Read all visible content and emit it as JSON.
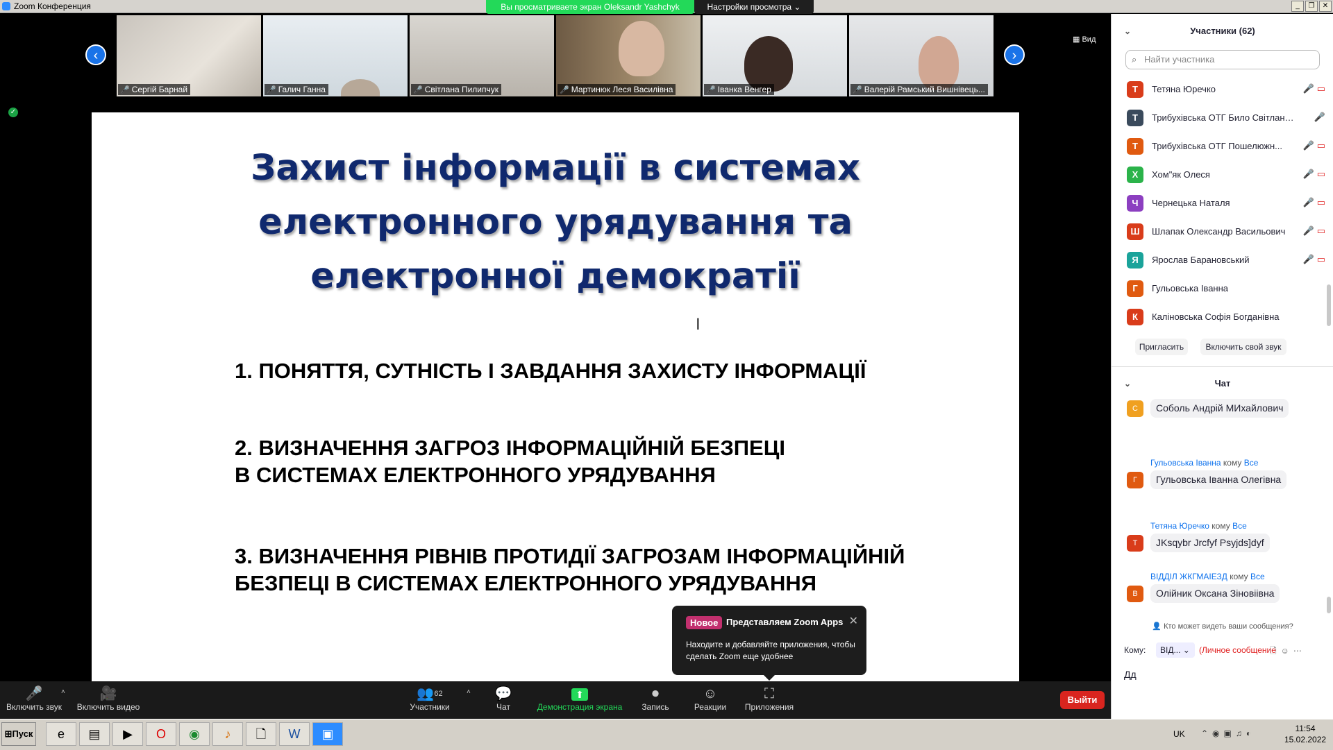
{
  "window": {
    "title": "Zoom Конференция",
    "share_banner": "Вы просматриваете экран Oleksandr Yashchyk",
    "view_options": "Настройки просмотра ⌄",
    "view_button": "Вид"
  },
  "video_tiles": [
    {
      "name": "Сергій Барнай"
    },
    {
      "name": "Галич Ганна"
    },
    {
      "name": "Світлана Пилипчук"
    },
    {
      "name": "Мартинюк Леся Василівна"
    },
    {
      "name": "Іванка Венгер"
    },
    {
      "name": "Валерій Рамський Вишнівець..."
    }
  ],
  "slide": {
    "title_line1": "Захист інформації в системах",
    "title_line2": "електронного урядування та",
    "title_line3": "електронної демократії",
    "item1": "1. ПОНЯТТЯ, СУТНІСТЬ І ЗАВДАННЯ ЗАХИСТУ ІНФОРМАЦІЇ",
    "item2_line1": "2. ВИЗНАЧЕННЯ ЗАГРОЗ ІНФОРМАЦІЙНІЙ БЕЗПЕЦІ",
    "item2_line2": "В СИСТЕМАХ ЕЛЕКТРОННОГО УРЯДУВАННЯ",
    "item3_line1": "3. ВИЗНАЧЕННЯ РІВНІВ ПРОТИДІЇ ЗАГРОЗАМ ІНФОРМАЦІЙНІЙ",
    "item3_line2": "БЕЗПЕЦІ В СИСТЕМАХ ЕЛЕКТРОННОГО УРЯДУВАННЯ"
  },
  "apps_popup": {
    "badge": "Новое",
    "heading": "Представляем Zoom Apps",
    "body": "Находите и добавляйте приложения, чтобы сделать Zoom еще удобнее"
  },
  "toolbar": {
    "audio": "Включить звук",
    "video": "Включить видео",
    "participants": "Участники",
    "participants_count": "62",
    "chat": "Чат",
    "share": "Демонстрация экрана",
    "record": "Запись",
    "reactions": "Реакции",
    "apps": "Приложения",
    "leave": "Выйти"
  },
  "participants_panel": {
    "title": "Участники (62)",
    "search_placeholder": "Найти участника",
    "items": [
      {
        "initial": "Т",
        "name": "Тетяна Юречко",
        "color": "#d93c1a"
      },
      {
        "initial": "Т",
        "name": "Трибухівська ОТГ Било Світлана ...",
        "color": "#3a4a5c"
      },
      {
        "initial": "Т",
        "name": "Трибухівська ОТГ Пошелюжн...",
        "color": "#e05a10"
      },
      {
        "initial": "Х",
        "name": "Хом\"як Олеся",
        "color": "#2bb34a"
      },
      {
        "initial": "Ч",
        "name": "Чернецька  Наталя",
        "color": "#8c3fc0"
      },
      {
        "initial": "Ш",
        "name": "Шлапак Олександр Васильович",
        "color": "#d93c1a"
      },
      {
        "initial": "Я",
        "name": "Ярослав Барановський",
        "color": "#1aa39a"
      },
      {
        "initial": "Г",
        "name": "Гульовська Іванна",
        "color": "#e05a10"
      },
      {
        "initial": "К",
        "name": "Каліновська Софія Богданівна",
        "color": "#d93c1a"
      }
    ],
    "invite": "Пригласить",
    "unmute": "Включить свой звук"
  },
  "chat_panel": {
    "title": "Чат",
    "messages": [
      {
        "initial": "С",
        "color": "#f0a020",
        "sender": "",
        "to": "",
        "target": "",
        "text": "Соболь Андрій МИхайлович"
      },
      {
        "initial": "Г",
        "color": "#e05a10",
        "sender": "Гульовська Іванна",
        "to": "кому",
        "target": "Все",
        "text": "Гульовська Іванна Олегівна"
      },
      {
        "initial": "Т",
        "color": "#d93c1a",
        "sender": "Тетяна Юречко",
        "to": "кому",
        "target": "Все",
        "text": "JKsqybr Jrcfyf Psyjds]dyf"
      },
      {
        "initial": "В",
        "color": "#e05a10",
        "sender": "ВІДДІЛ ЖКГМАІЕЗД",
        "to": "кому",
        "target": "Все",
        "text": "Олійник Оксана Зіновіівна"
      }
    ],
    "privacy": "Кто может видеть ваши сообщения?",
    "to_label": "Кому:",
    "recipient": "ВІД...",
    "private_note": "(Личное сообщение",
    "input": "Дд"
  },
  "taskbar": {
    "start": "Пуск",
    "lang": "UK",
    "time": "11:54",
    "date": "15.02.2022"
  }
}
